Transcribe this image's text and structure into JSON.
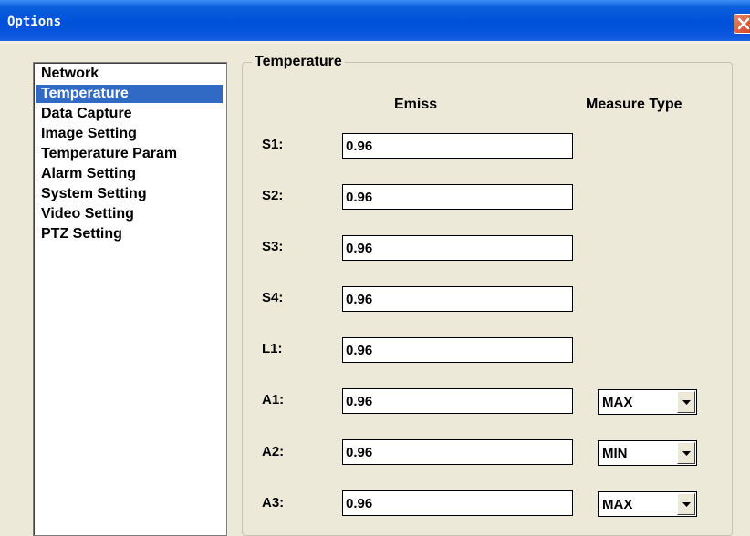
{
  "window": {
    "title": "Options"
  },
  "sidebar": {
    "items": [
      {
        "label": "Network"
      },
      {
        "label": "Temperature"
      },
      {
        "label": "Data Capture"
      },
      {
        "label": "Image Setting"
      },
      {
        "label": "Temperature Param"
      },
      {
        "label": "Alarm Setting"
      },
      {
        "label": "System Setting"
      },
      {
        "label": "Video Setting"
      },
      {
        "label": "PTZ Setting"
      }
    ],
    "selected": "Temperature"
  },
  "panel": {
    "title": "Temperature",
    "emiss_header": "Emiss",
    "measure_header": "Measure Type",
    "rows": [
      {
        "label": "S1:",
        "emiss": "0.96"
      },
      {
        "label": "S2:",
        "emiss": "0.96"
      },
      {
        "label": "S3:",
        "emiss": "0.96"
      },
      {
        "label": "S4:",
        "emiss": "0.96"
      },
      {
        "label": "L1:",
        "emiss": "0.96"
      },
      {
        "label": "A1:",
        "emiss": "0.96",
        "measure": "MAX"
      },
      {
        "label": "A2:",
        "emiss": "0.96",
        "measure": "MIN"
      },
      {
        "label": "A3:",
        "emiss": "0.96",
        "measure": "MAX"
      }
    ]
  },
  "colors": {
    "titlebar": "#0050d8",
    "selection": "#316ac5",
    "dialog_bg": "#ece9d8",
    "close_button": "#d2411f"
  }
}
